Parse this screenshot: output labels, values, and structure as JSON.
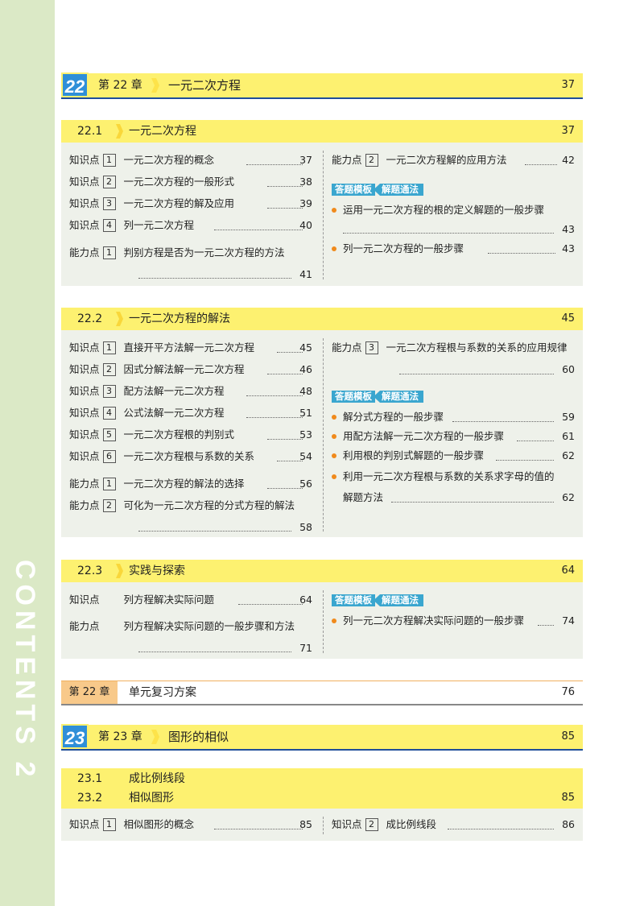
{
  "sidebar": {
    "text": "CONTENTS 2"
  },
  "chapters": [
    {
      "badge": "22",
      "num": "第 22 章",
      "title": "一元二次方程",
      "page": "37"
    },
    {
      "badge": "23",
      "num": "第 23 章",
      "title": "图形的相似",
      "page": "85"
    }
  ],
  "sections": [
    {
      "num": "22.1",
      "title": "一元二次方程",
      "page": "37",
      "left": [
        {
          "label": "知识点",
          "box": "1",
          "text": "一元二次方程的概念",
          "page": "37"
        },
        {
          "label": "知识点",
          "box": "2",
          "text": "一元二次方程的一般形式",
          "page": "38"
        },
        {
          "label": "知识点",
          "box": "3",
          "text": "一元二次方程的解及应用",
          "page": "39"
        },
        {
          "label": "知识点",
          "box": "4",
          "text": "列一元二次方程",
          "page": "40"
        },
        {
          "label": "能力点",
          "box": "1",
          "text": "判别方程是否为一元二次方程的方法",
          "page": "41"
        }
      ],
      "right_ability": {
        "label": "能力点",
        "box": "2",
        "text": "一元二次方程解的应用方法",
        "page": "42"
      },
      "template": {
        "a": "答题模板",
        "b": "解题通法"
      },
      "bullets": [
        {
          "text": "运用一元二次方程的根的定义解题的一般步骤",
          "page": "43"
        },
        {
          "text": "列一元二次方程的一般步骤",
          "page": "43"
        }
      ]
    },
    {
      "num": "22.2",
      "title": "一元二次方程的解法",
      "page": "45",
      "left": [
        {
          "label": "知识点",
          "box": "1",
          "text": "直接开平方法解一元二次方程",
          "page": "45"
        },
        {
          "label": "知识点",
          "box": "2",
          "text": "因式分解法解一元二次方程",
          "page": "46"
        },
        {
          "label": "知识点",
          "box": "3",
          "text": "配方法解一元二次方程",
          "page": "48"
        },
        {
          "label": "知识点",
          "box": "4",
          "text": "公式法解一元二次方程",
          "page": "51"
        },
        {
          "label": "知识点",
          "box": "5",
          "text": "一元二次方程根的判别式",
          "page": "53"
        },
        {
          "label": "知识点",
          "box": "6",
          "text": "一元二次方程根与系数的关系",
          "page": "54"
        },
        {
          "label": "能力点",
          "box": "1",
          "text": "一元二次方程的解法的选择",
          "page": "56"
        },
        {
          "label": "能力点",
          "box": "2",
          "text": "可化为一元二次方程的分式方程的解法",
          "page": "58"
        }
      ],
      "right_ability": {
        "label": "能力点",
        "box": "3",
        "text": "一元二次方程根与系数的关系的应用规律",
        "page": "60"
      },
      "template": {
        "a": "答题模板",
        "b": "解题通法"
      },
      "bullets": [
        {
          "text": "解分式方程的一般步骤",
          "page": "59"
        },
        {
          "text": "用配方法解一元二次方程的一般步骤",
          "page": "61"
        },
        {
          "text": "利用根的判别式解题的一般步骤",
          "page": "62"
        },
        {
          "text": "利用一元二次方程根与系数的关系求字母的值的",
          "text2": "解题方法",
          "page": "62"
        }
      ]
    },
    {
      "num": "22.3",
      "title": "实践与探索",
      "page": "64",
      "left": [
        {
          "label": "知识点",
          "text": "列方程解决实际问题",
          "page": "64"
        },
        {
          "label": "能力点",
          "text": "列方程解决实际问题的一般步骤和方法",
          "page": "71"
        }
      ],
      "template": {
        "a": "答题模板",
        "b": "解题通法"
      },
      "bullets": [
        {
          "text": "列一元二次方程解决实际问题的一般步骤",
          "page": "74"
        }
      ]
    }
  ],
  "review": {
    "tag": "第 22 章",
    "title": "单元复习方案",
    "page": "76"
  },
  "section23": {
    "num1": "23.1",
    "title1": "成比例线段",
    "num2": "23.2",
    "title2": "相似图形",
    "page": "85",
    "left": {
      "label": "知识点",
      "box": "1",
      "text": "相似图形的概念",
      "page": "85"
    },
    "right": {
      "label": "知识点",
      "box": "2",
      "text": "成比例线段",
      "page": "86"
    }
  }
}
